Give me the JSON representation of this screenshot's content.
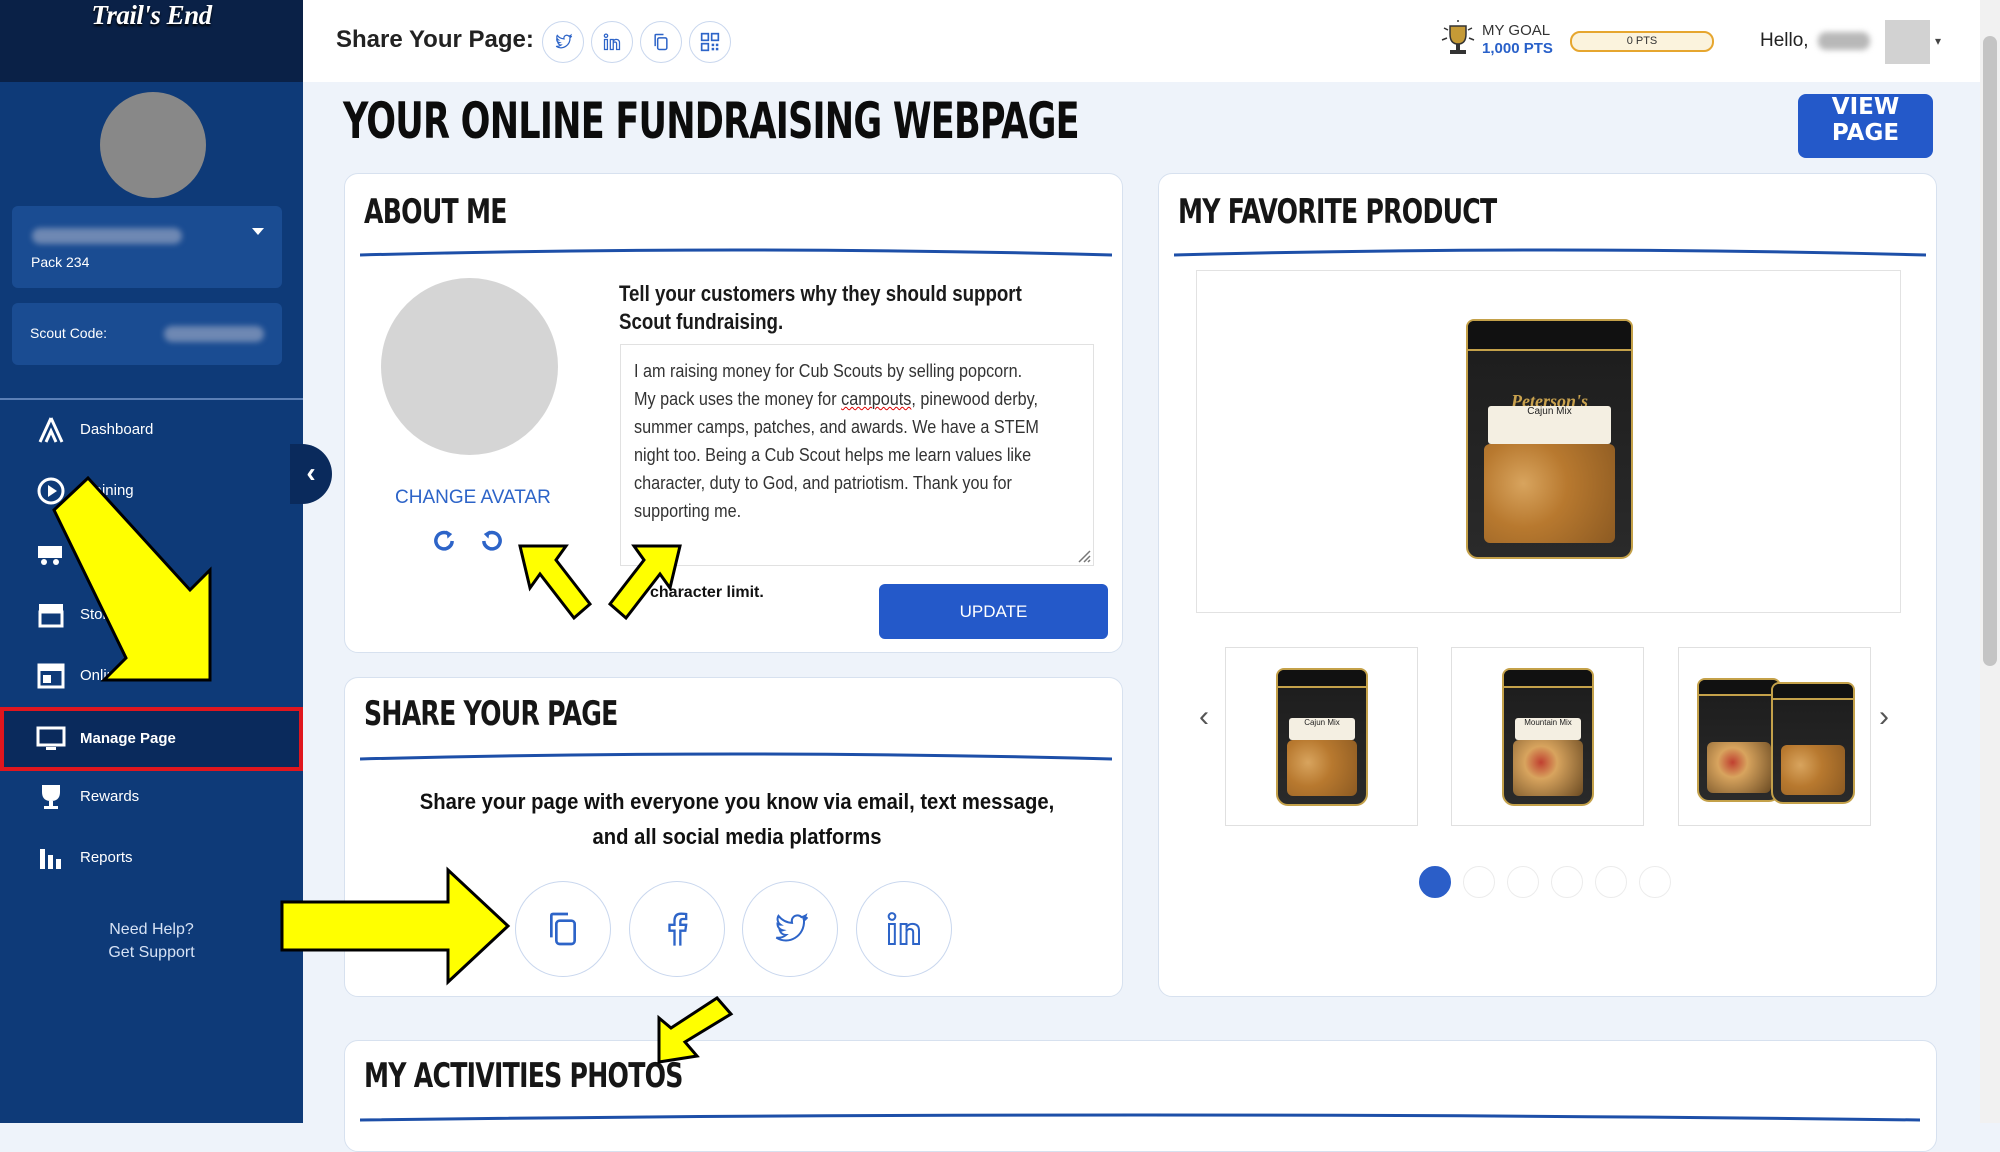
{
  "brand": "Trail's End",
  "sidebar": {
    "pack": "Pack 234",
    "scout_code_label": "Scout Code:",
    "nav": [
      {
        "label": "Dashboard",
        "icon": "tent-icon"
      },
      {
        "label": "Training",
        "icon": "play-icon"
      },
      {
        "label": "",
        "icon": "wagon-icon"
      },
      {
        "label": "Store",
        "icon": "storefront-icon"
      },
      {
        "label": "Online",
        "icon": "browser-icon"
      },
      {
        "label": "Manage Page",
        "icon": "monitor-icon"
      },
      {
        "label": "Rewards",
        "icon": "trophy-icon"
      },
      {
        "label": "Reports",
        "icon": "bar-chart-icon"
      }
    ],
    "help_line1": "Need Help?",
    "help_line2": "Get Support"
  },
  "topbar": {
    "share_title": "Share Your Page:",
    "goal_label": "MY GOAL",
    "goal_value": "1,000 PTS",
    "progress_text": "0 PTS",
    "progress_fraction": 0,
    "hello": "Hello,"
  },
  "page": {
    "headline": "YOUR ONLINE FUNDRAISING WEBPAGE",
    "view_button": "VIEW PAGE"
  },
  "about": {
    "title": "ABOUT ME",
    "change_avatar": "CHANGE AVATAR",
    "prompt": "Tell your customers why they should support Scout fundraising.",
    "text_before": "I am raising money for Cub Scouts by selling popcorn.  My pack uses the money for ",
    "text_misspelled": "campouts",
    "text_after": ", pinewood derby, summer camps, patches, and awards.  We have a STEM night too.  Being a Cub Scout helps me learn values like character, duty to God, and patriotism.  Thank you for supporting me.",
    "char_limit": "character limit.",
    "update_button": "UPDATE"
  },
  "share": {
    "title": "SHARE YOUR PAGE",
    "description": "Share your page with everyone you know via email, text message, and all social media platforms"
  },
  "product": {
    "title": "MY FAVORITE PRODUCT",
    "main_label": "Cajun Mix",
    "brand_on_bag": "Peterson's",
    "thumbs": [
      "Cajun Mix",
      "Mountain Mix",
      "Cajun Mix / Mountain Mix"
    ]
  },
  "activities": {
    "title": "MY ACTIVITIES PHOTOS"
  },
  "colors": {
    "sidebar": "#0e3a78",
    "accent": "#2459c9",
    "highlight_box": "#e0161e",
    "arrow": "#ffff00"
  }
}
